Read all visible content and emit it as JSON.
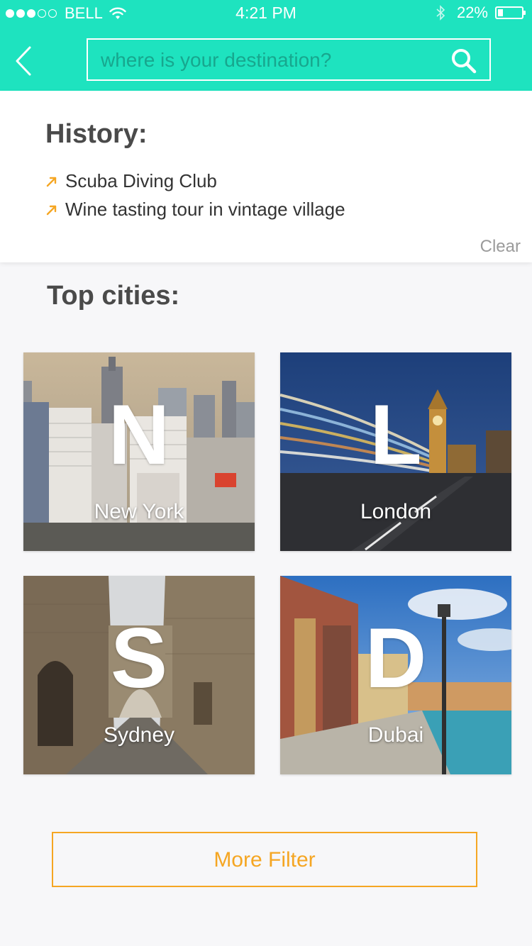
{
  "status_bar": {
    "carrier": "BELL",
    "time": "4:21 PM",
    "battery": "22%",
    "battery_level": 0.22
  },
  "header": {
    "search_placeholder": "where is your destination?"
  },
  "history": {
    "title": "History:",
    "items": [
      {
        "label": "Scuba Diving Club"
      },
      {
        "label": "Wine tasting tour in vintage village"
      }
    ],
    "clear_label": "Clear"
  },
  "top_cities": {
    "title": "Top cities:",
    "cities": [
      {
        "letter": "N",
        "name": "New York"
      },
      {
        "letter": "L",
        "name": "London"
      },
      {
        "letter": "S",
        "name": "Sydney"
      },
      {
        "letter": "D",
        "name": "Dubai"
      }
    ]
  },
  "more_filter_label": "More Filter",
  "colors": {
    "accent": "#1ee3bf",
    "button": "#f5a623",
    "arrow": "#f5a623"
  }
}
